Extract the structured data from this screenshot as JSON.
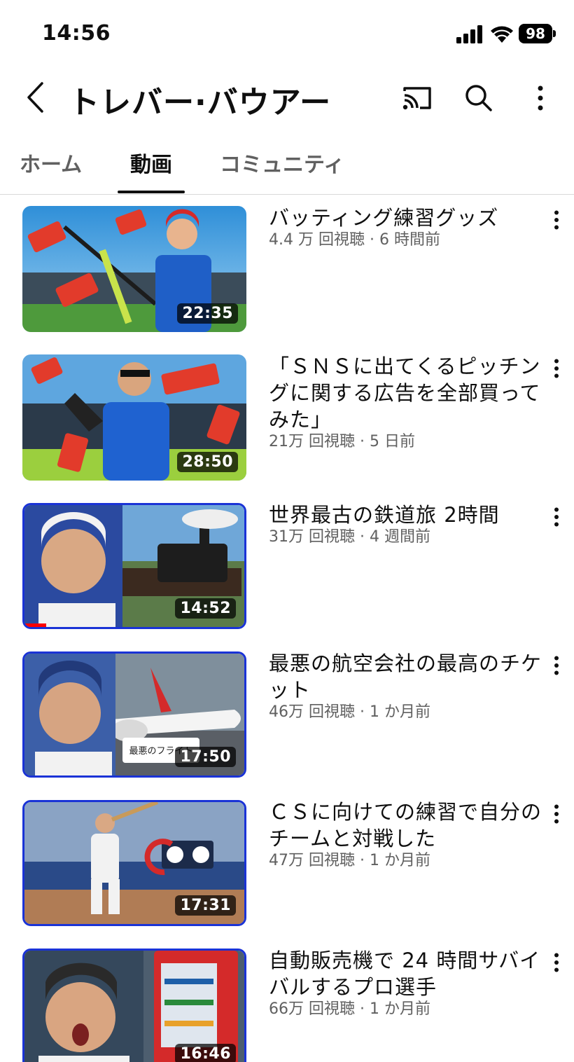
{
  "status_bar": {
    "time": "14:56",
    "battery": "98"
  },
  "header": {
    "title": "トレバー·バウアー"
  },
  "tabs": [
    {
      "label": "ホーム",
      "active": false
    },
    {
      "label": "動画",
      "active": true
    },
    {
      "label": "コミュニティ",
      "active": false
    }
  ],
  "videos": [
    {
      "title": "バッティング練習グッズ",
      "views": "4.4 万 回視聴",
      "age": "6 時間前",
      "duration": "22:35",
      "progress": 0
    },
    {
      "title": "「ＳＮＳに出てくるピッチングに関する広告を全部買ってみた」",
      "views": "21万 回視聴",
      "age": "5 日前",
      "duration": "28:50",
      "progress": 0
    },
    {
      "title": "世界最古の鉄道旅 2時間",
      "views": "31万 回視聴",
      "age": "4 週間前",
      "duration": "14:52",
      "progress": 0.1
    },
    {
      "title": "最悪の航空会社の最高のチケット",
      "views": "46万 回視聴",
      "age": "1 か月前",
      "duration": "17:50",
      "progress": 0
    },
    {
      "title": "ＣＳに向けての練習で自分のチームと対戦した",
      "views": "47万 回視聴",
      "age": "1 か月前",
      "duration": "17:31",
      "progress": 0
    },
    {
      "title": "自動販売機で 24 時間サバイバルするプロ選手",
      "views": "66万 回視聴",
      "age": "1 か月前",
      "duration": "16:46",
      "progress": 0
    }
  ],
  "thumbnail_text": {
    "v4_caption": "最悪のフライト"
  },
  "colors": {
    "accent": "#0f0f0f",
    "muted": "#606060",
    "progress": "#ff0000"
  },
  "icons": [
    "back-arrow-icon",
    "cast-icon",
    "search-icon",
    "more-vert-icon"
  ]
}
